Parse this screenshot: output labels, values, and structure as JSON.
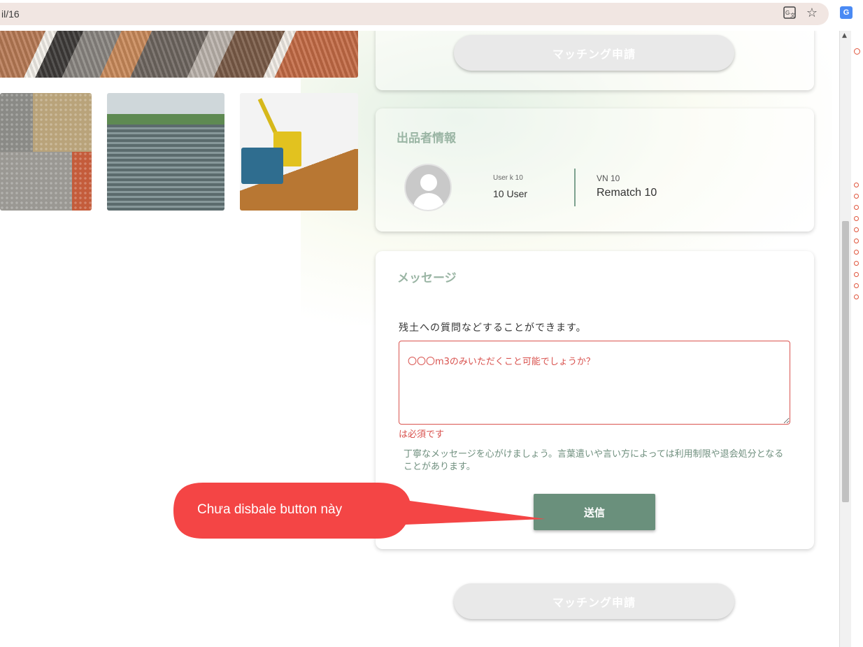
{
  "browser": {
    "url": "il/16",
    "icons": [
      "translate-icon",
      "star-icon",
      "extension-icon"
    ]
  },
  "top_card": {
    "matching_button": "マッチング申請"
  },
  "seller": {
    "title": "出品者情報",
    "user_small": "User k    10",
    "user_big": "10   User",
    "vn_small": "VN 10",
    "vn_big": "Rematch 10"
  },
  "message": {
    "title": "メッセージ",
    "description": "残土への質問などすることができます。",
    "textarea_placeholder": "〇〇〇m3のみいただくこと可能でしょうか？",
    "error": "は必須です",
    "hint": "丁寧なメッセージを心がけましょう。言葉遣いや言い方によっては利用制限や退会処分となることがあります。",
    "send_button": "送信"
  },
  "bottom": {
    "matching_button": "マッチング申請"
  },
  "annotation": {
    "text": "Chưa disbale button này",
    "color": "#f44545"
  },
  "colors": {
    "accent_green": "#6a907c",
    "title_green": "#9ab5a4",
    "error_red": "#d9534f"
  }
}
